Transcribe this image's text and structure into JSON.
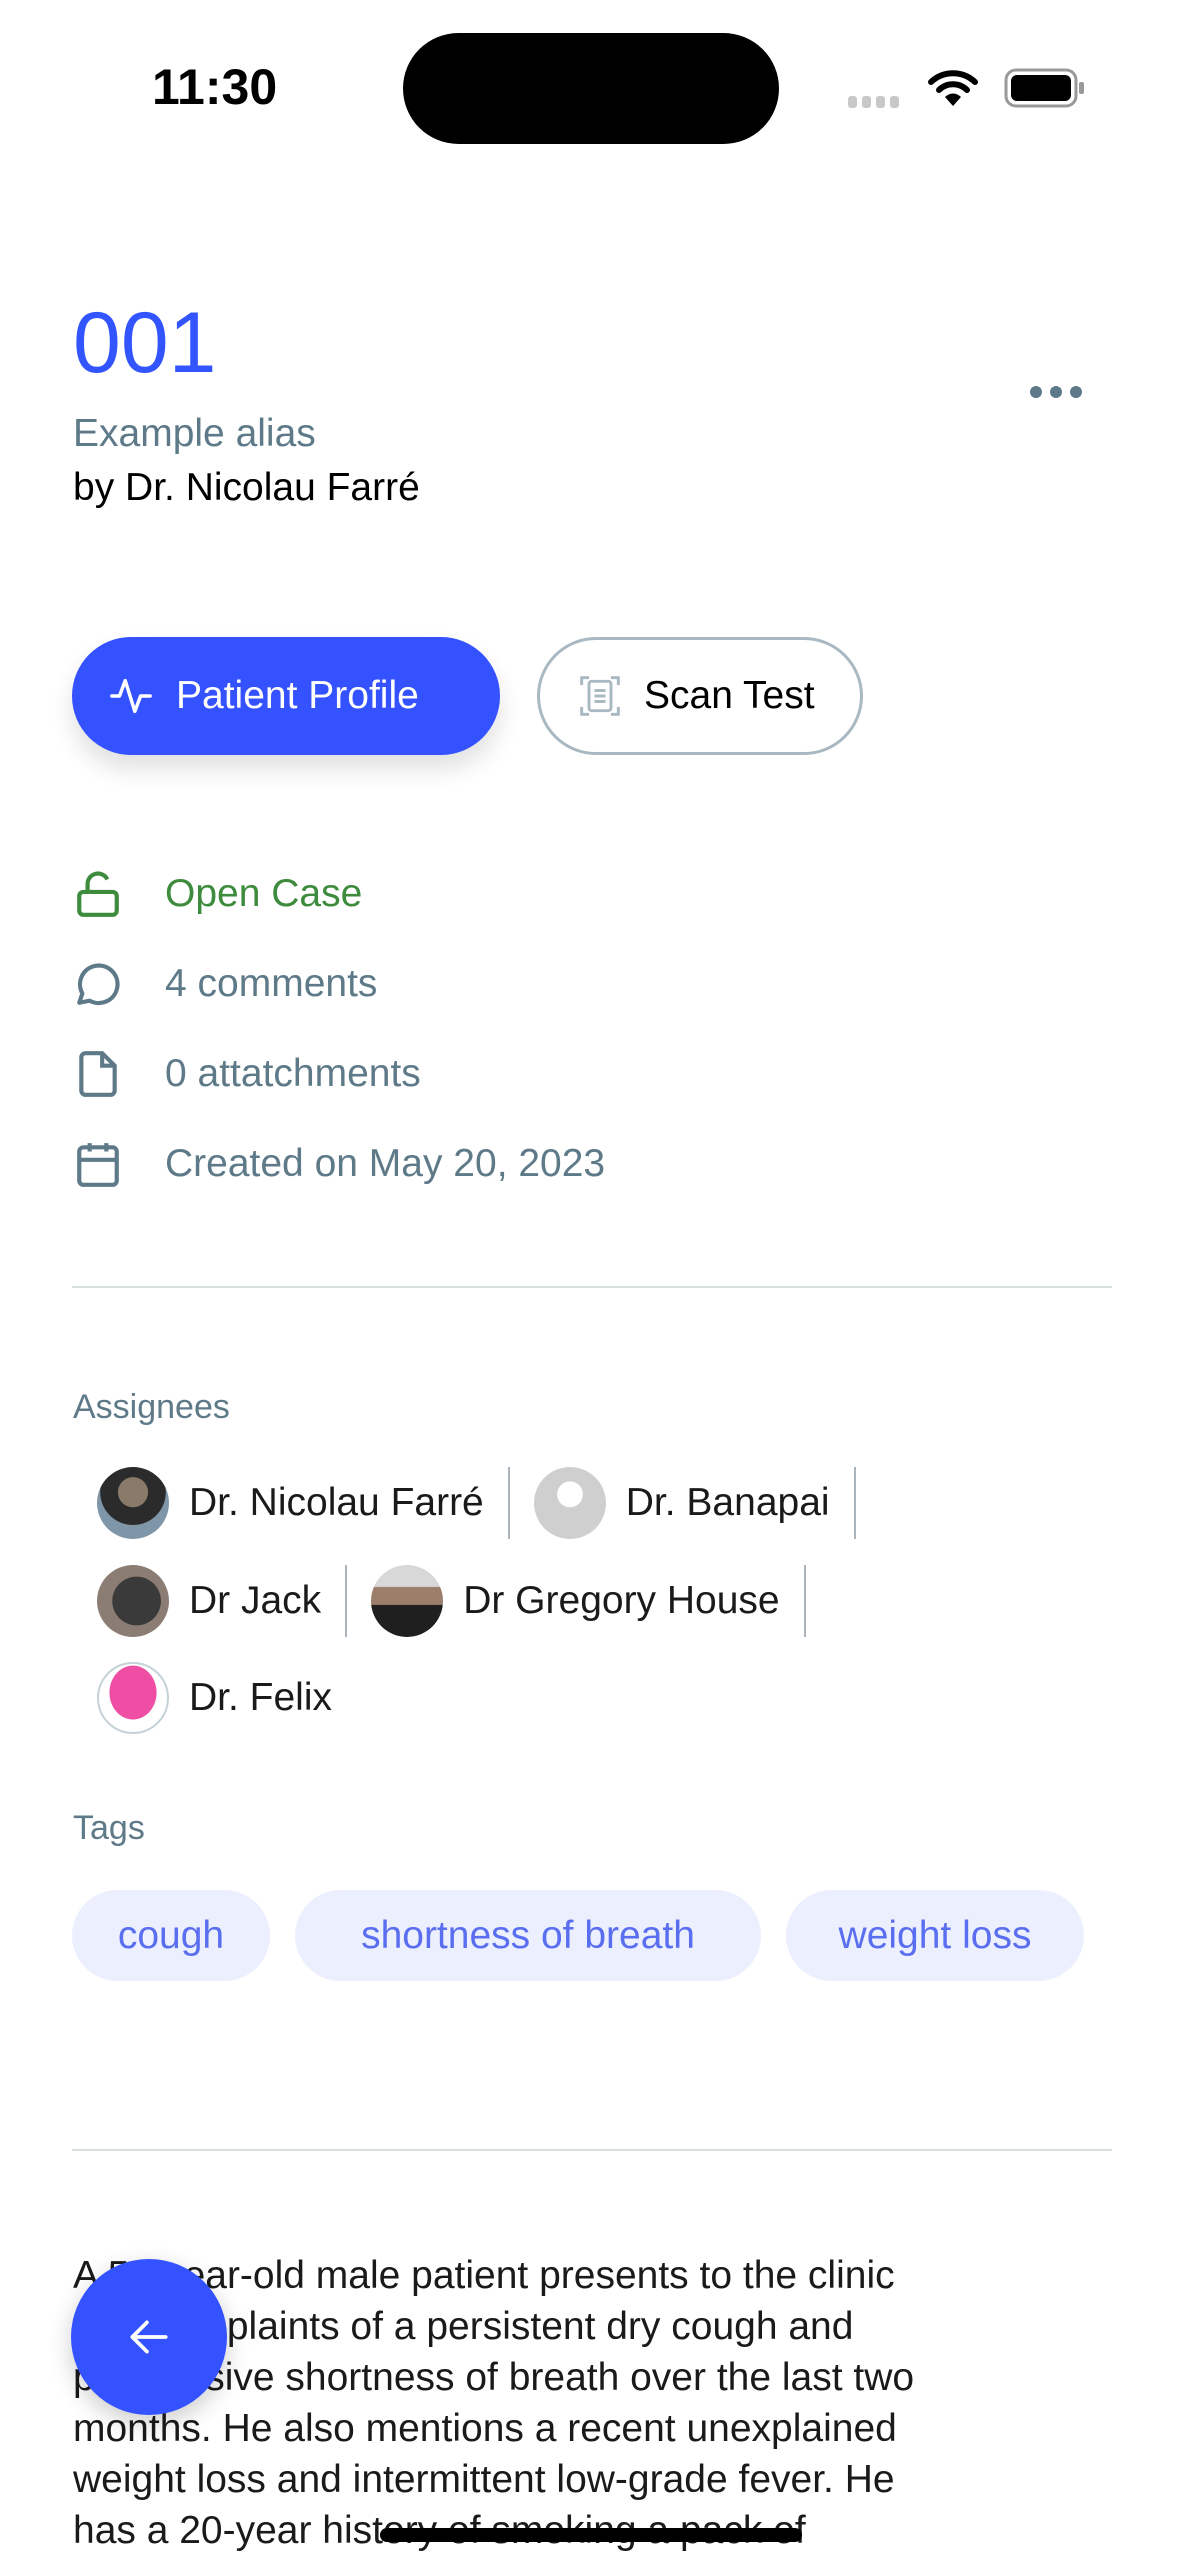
{
  "status_bar": {
    "time": "11:30"
  },
  "header": {
    "case_number": "001",
    "alias": "Example alias",
    "author": "by Dr. Nicolau Farré",
    "more_icon": "ellipsis-icon"
  },
  "actions": {
    "patient_profile": "Patient Profile",
    "scan_test": "Scan Test"
  },
  "info": {
    "status": "Open Case",
    "comments": "4 comments",
    "attachments": "0 attatchments",
    "created": "Created on May 20, 2023"
  },
  "colors": {
    "accent": "#3452ff",
    "open_status": "#3d8b3d",
    "muted": "#5e7a88",
    "tag_bg": "#eceffd",
    "tag_text": "#5a6ef0"
  },
  "assignees": {
    "label": "Assignees",
    "people": [
      {
        "name": "Dr. Nicolau Farré"
      },
      {
        "name": "Dr. Banapai"
      },
      {
        "name": "Dr Jack"
      },
      {
        "name": "Dr Gregory House"
      },
      {
        "name": "Dr. Felix"
      }
    ]
  },
  "tags": {
    "label": "Tags",
    "items": [
      "cough",
      "shortness of breath",
      "weight loss"
    ]
  },
  "description": {
    "lines": [
      "A 55-year-old male patient presents to the clinic",
      "with complaints of a persistent dry cough and",
      "progressive shortness of breath over the last two",
      "months. He also mentions a recent unexplained",
      "weight loss and intermittent low-grade fever. He",
      "has a 20-year history of smoking a pack of"
    ]
  },
  "fab": {
    "icon": "arrow-left-icon"
  }
}
